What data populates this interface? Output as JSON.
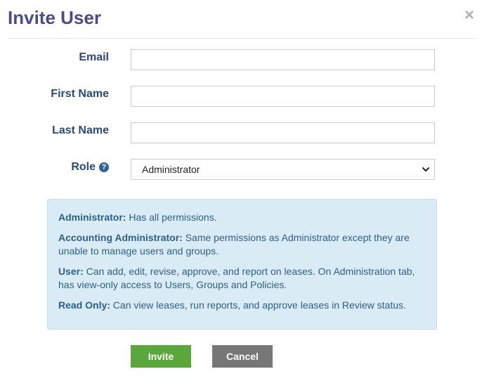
{
  "dialog": {
    "title": "Invite User",
    "close_symbol": "×"
  },
  "form": {
    "email": {
      "label": "Email",
      "value": "",
      "placeholder": ""
    },
    "first_name": {
      "label": "First Name",
      "value": "",
      "placeholder": ""
    },
    "last_name": {
      "label": "Last Name",
      "value": "",
      "placeholder": ""
    },
    "role": {
      "label": "Role",
      "help_symbol": "?",
      "selected": "Administrator"
    }
  },
  "role_descriptions": [
    {
      "name": "Administrator:",
      "text": " Has all permissions."
    },
    {
      "name": "Accounting Administrator:",
      "text": " Same permissions as Administrator except they are unable to manage users and groups."
    },
    {
      "name": "User:",
      "text": " Can add, edit, revise, approve, and report on leases. On Administration tab, has view-only access to Users, Groups and Policies."
    },
    {
      "name": "Read Only:",
      "text": " Can view leases, run reports, and approve leases in Review status."
    }
  ],
  "actions": {
    "invite_label": "Invite",
    "cancel_label": "Cancel"
  },
  "colors": {
    "title": "#4b4a8c",
    "label": "#2b4a7a",
    "info_bg": "#d9ecf6",
    "info_text": "#2f5f86",
    "invite_button": "#5aa83c",
    "cancel_button": "#777777"
  },
  "icons": {
    "close": "close-icon",
    "help": "help-circle-icon",
    "dropdown": "chevron-down-icon"
  }
}
